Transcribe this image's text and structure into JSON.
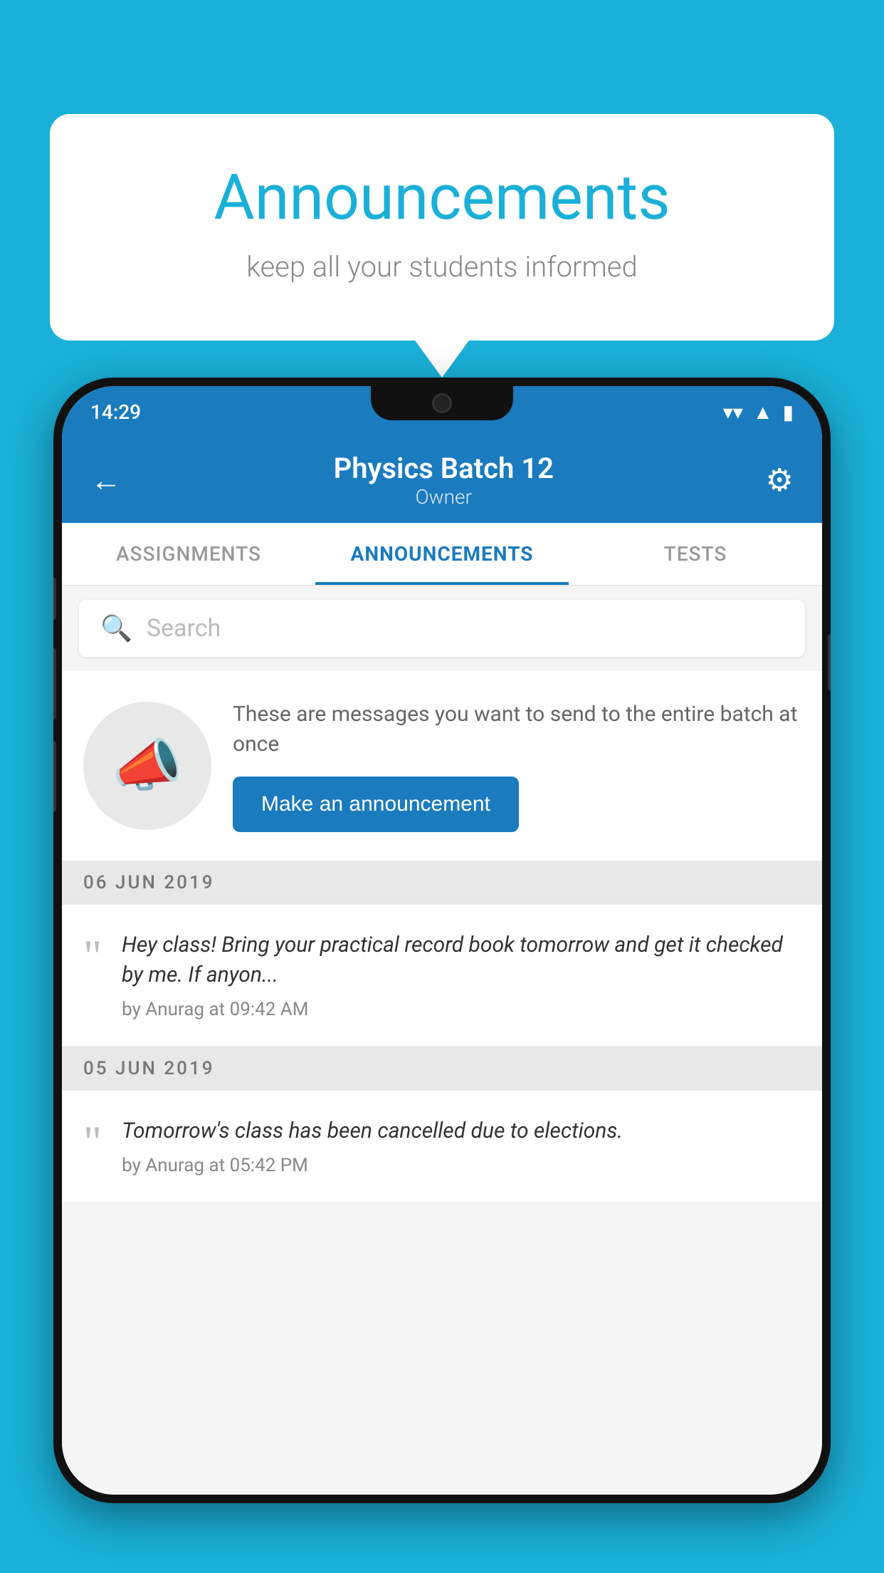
{
  "background_color": "#1ab0d8",
  "speech_bubble": {
    "title": "Announcements",
    "subtitle": "keep all your students informed"
  },
  "phone": {
    "status_bar": {
      "time": "14:29",
      "wifi_icon": "▼",
      "signal_icon": "▲",
      "battery_icon": "▮"
    },
    "header": {
      "back_label": "←",
      "title": "Physics Batch 12",
      "subtitle": "Owner",
      "gear_label": "⚙"
    },
    "tabs": [
      {
        "label": "ASSIGNMENTS",
        "active": false
      },
      {
        "label": "ANNOUNCEMENTS",
        "active": true
      },
      {
        "label": "TESTS",
        "active": false
      }
    ],
    "search": {
      "placeholder": "Search"
    },
    "promo": {
      "description": "These are messages you want to send to the entire batch at once",
      "button_label": "Make an announcement"
    },
    "announcements": [
      {
        "date": "06  JUN  2019",
        "text": "Hey class! Bring your practical record book tomorrow and get it checked by me. If anyon...",
        "meta": "by Anurag at 09:42 AM"
      },
      {
        "date": "05  JUN  2019",
        "text": "Tomorrow's class has been cancelled due to elections.",
        "meta": "by Anurag at 05:42 PM"
      }
    ]
  }
}
